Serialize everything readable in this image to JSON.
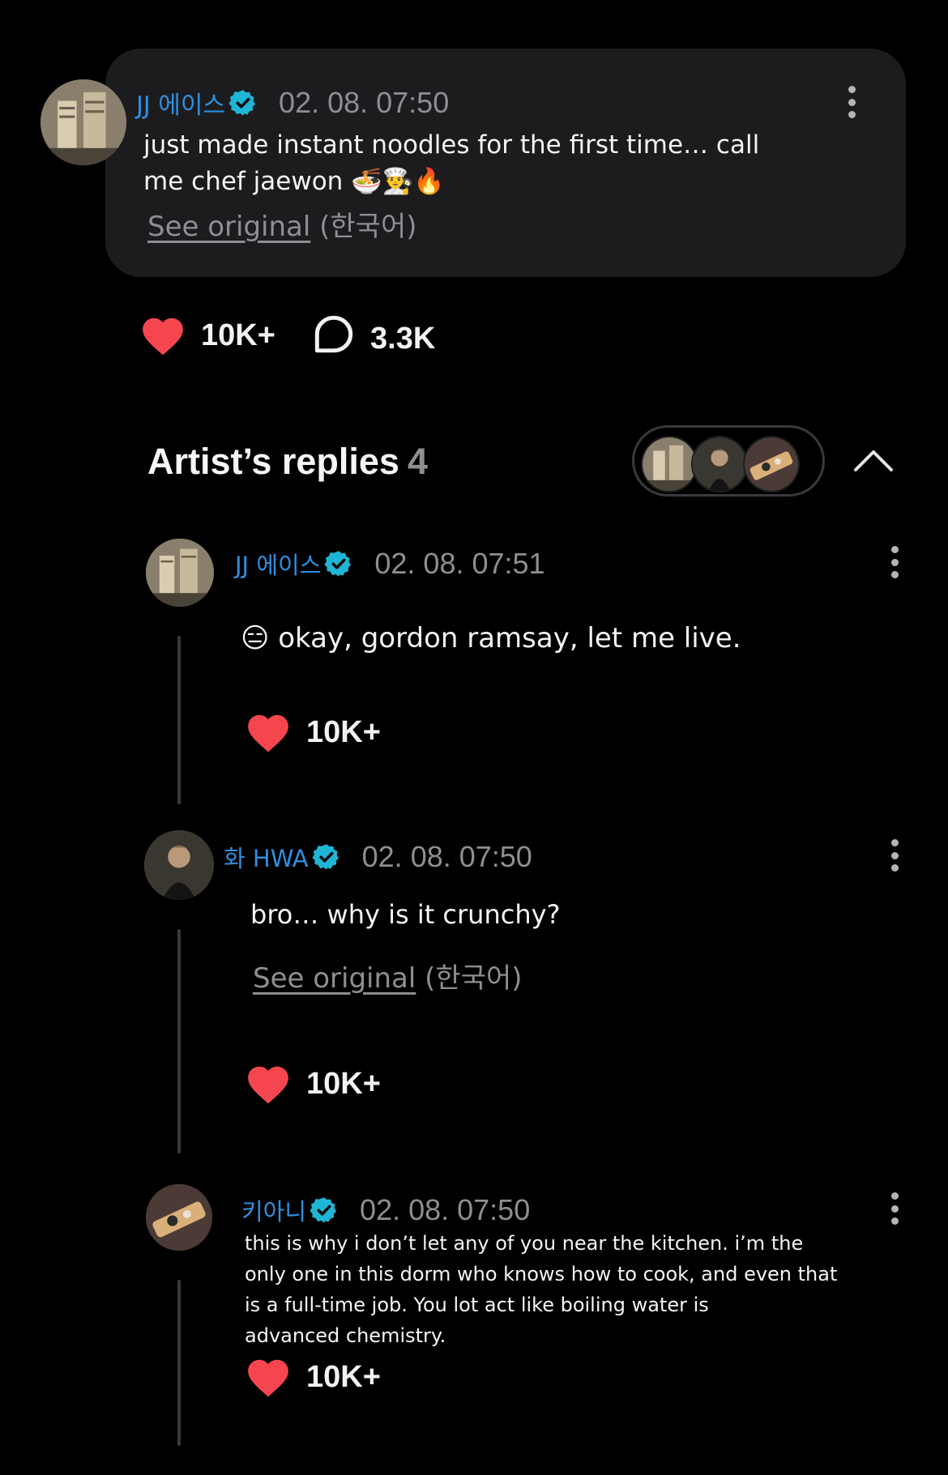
{
  "post": {
    "author": "JJ 에이스",
    "timestamp": "02. 08. 07:50",
    "text_line1": "just made instant noodles for the first time… call",
    "text_line2": "me chef jaewon 🍜👨‍🍳🔥",
    "see_original": "See original",
    "language": "(한국어)",
    "likes": "10K+",
    "comments": "3.3K"
  },
  "replies_section": {
    "title": "Artist’s replies",
    "count": "4"
  },
  "replies": [
    {
      "author": "JJ 에이스",
      "timestamp": "02. 08. 07:51",
      "text": "😑 okay, gordon ramsay, let me live.",
      "likes": "10K+"
    },
    {
      "author": "화 HWA",
      "timestamp": "02. 08. 07:50",
      "text": "bro… why is it crunchy?",
      "see_original": "See original",
      "language": "(한국어)",
      "likes": "10K+"
    },
    {
      "author": "키아니",
      "timestamp": "02. 08. 07:50",
      "text_lines": [
        "this is why i don’t let any of you near the kitchen. i’m the",
        "only one in this dorm who knows how to cook, and even that",
        "is a full-time job. You lot act like boiling water is",
        "advanced chemistry."
      ],
      "likes": "10K+"
    }
  ],
  "icons": {
    "heart": "heart-icon",
    "comment": "comment-bubble-icon",
    "verified": "verified-badge-icon",
    "more": "more-vertical-icon",
    "collapse": "chevron-up-icon"
  },
  "colors": {
    "background": "#000000",
    "card": "#1c1c1e",
    "author_blue": "#2f8fe0",
    "verified_teal": "#1fb6d6",
    "heart_red": "#f5464f",
    "muted_gray": "#8e8e93"
  }
}
